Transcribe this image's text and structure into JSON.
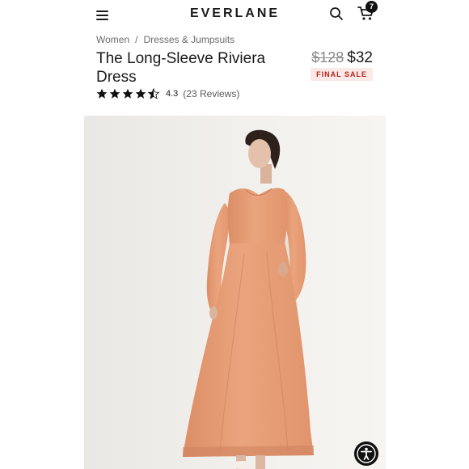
{
  "header": {
    "logo": "EVERLANE",
    "cart_count": "7"
  },
  "breadcrumb": {
    "items": [
      "Women",
      "Dresses & Jumpsuits"
    ],
    "separator": "/"
  },
  "product": {
    "title": "The Long-Sleeve Riviera Dress",
    "original_price": "$128",
    "sale_price": "$32",
    "sale_badge": "FINAL SALE",
    "rating_value": "4.3",
    "rating_fraction": 0.86,
    "review_count": "(23 Reviews)"
  },
  "image": {
    "subject": "Model wearing a peach long-sleeve midi dress"
  },
  "icons": {
    "menu": "menu-icon",
    "search": "search-icon",
    "cart": "cart-icon",
    "star": "star-icon",
    "accessibility": "accessibility-icon"
  },
  "colors": {
    "sale_badge_bg": "#fbe9e7",
    "sale_badge_text": "#b3261e",
    "dress": "#e8a07a",
    "photo_bg": "#f0efec"
  }
}
